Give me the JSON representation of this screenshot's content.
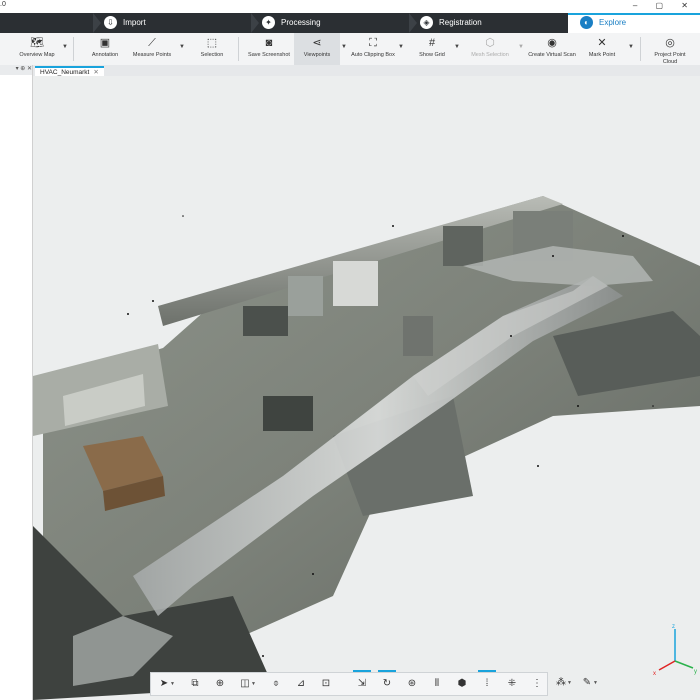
{
  "titlebar": {
    "version": ".0"
  },
  "tabs": [
    {
      "label": "Import",
      "icon": "import-icon"
    },
    {
      "label": "Processing",
      "icon": "processing-icon"
    },
    {
      "label": "Registration",
      "icon": "registration-icon"
    },
    {
      "label": "Explore",
      "icon": "explore-icon",
      "active": true
    }
  ],
  "toolbar": {
    "overview_map": "Overview Map",
    "annotation": "Annotation",
    "measure_points": "Measure Points",
    "selection": "Selection",
    "save_screenshot": "Save Screenshot",
    "viewpoints": "Viewpoints",
    "auto_clipping_box": "Auto Clipping Box",
    "show_grid": "Show Grid",
    "mesh_selection": "Mesh Selection",
    "create_virtual_scan": "Create Virtual Scan",
    "mark_point": "Mark Point",
    "project_point_cloud": "Project Point Cloud"
  },
  "document": {
    "tab_title": "HVAC_Neumarkt"
  },
  "colors": {
    "accent": "#19a3dc",
    "tabbar": "#2b2f33",
    "viewport_bg": "#eceeee"
  },
  "navbar_icons": [
    "navigate-icon",
    "view-box-icon",
    "zoom-icon",
    "cube-view-icon",
    "orbit-icon",
    "ruler-icon",
    "cut-plane-icon",
    "select-points-icon",
    "refresh-icon",
    "compass-icon",
    "clip-box-icon",
    "scan-icon",
    "cube-icon",
    "intensity-icon",
    "grid-dots-icon",
    "colors-icon",
    "palette-icon"
  ]
}
